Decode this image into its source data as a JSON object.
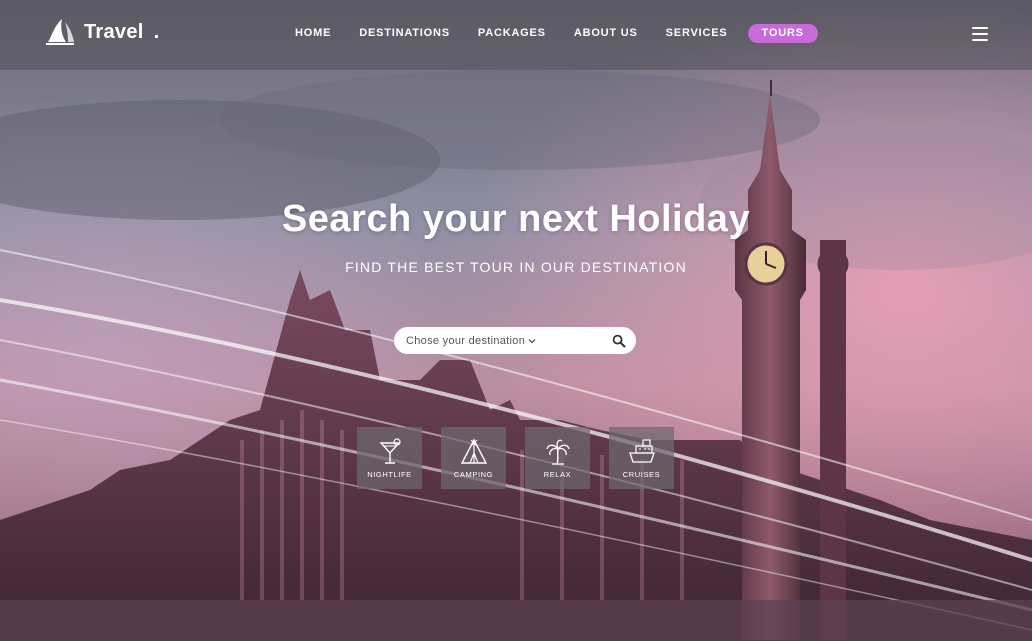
{
  "brand": {
    "name": "Travel",
    "dot": ".",
    "logo_icon": "sailboat-icon"
  },
  "nav": {
    "items": [
      {
        "label": "HOME"
      },
      {
        "label": "DESTINATIONS"
      },
      {
        "label": "PACKAGES"
      },
      {
        "label": "ABOUT US"
      },
      {
        "label": "SERVICES"
      },
      {
        "label": "TOURS",
        "active": true
      }
    ],
    "menu_icon": "hamburger-menu-icon"
  },
  "hero": {
    "title_prefix": "Search your next",
    "title_highlight": "Holiday",
    "subtitle": "FIND THE BEST TOUR IN OUR DESTINATION"
  },
  "search": {
    "placeholder": "Chose your destination",
    "dropdown_icon": "chevron-down-icon",
    "search_icon": "search-icon"
  },
  "categories": [
    {
      "label": "NIGHTLIFE",
      "icon": "cocktail-icon"
    },
    {
      "label": "CAMPING",
      "icon": "tent-icon"
    },
    {
      "label": "RELAX",
      "icon": "palm-tree-icon"
    },
    {
      "label": "CRUISES",
      "icon": "cruise-ship-icon"
    }
  ],
  "colors": {
    "accent": "#c86bd9",
    "header_bg": "rgba(70,70,78,0.45)",
    "tile_bg": "rgba(110,104,112,0.72)",
    "text_light": "#ffffff"
  }
}
